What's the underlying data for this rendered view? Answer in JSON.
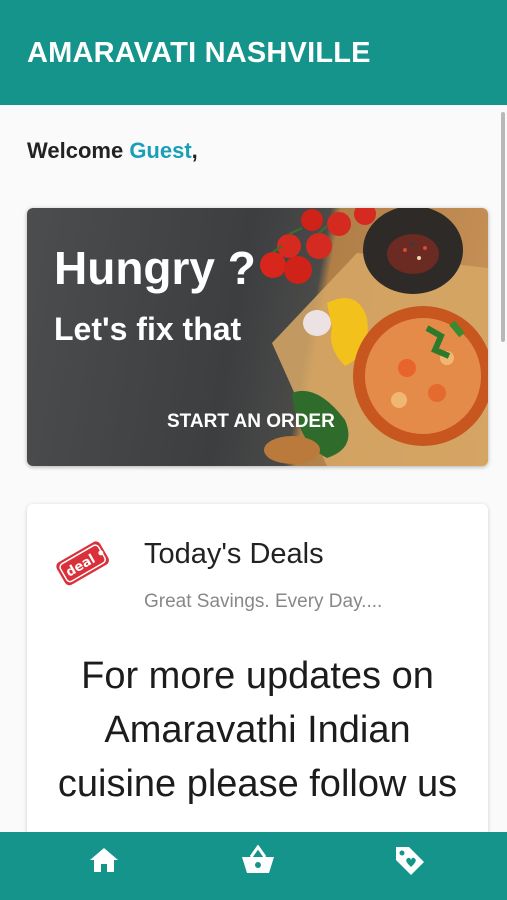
{
  "header": {
    "title": "AMARAVATI NASHVILLE"
  },
  "welcome": {
    "prefix": "Welcome ",
    "user": "Guest",
    "suffix": ","
  },
  "hero": {
    "title": "Hungry ?",
    "subtitle": "Let's fix that",
    "cta_label": "START AN ORDER"
  },
  "deals": {
    "icon_label": "deal",
    "title": "Today's Deals",
    "subtitle": "Great Savings. Every Day....",
    "body": "For more updates on Amaravathi Indian cuisine please follow us"
  },
  "bottom_nav": {
    "items": [
      {
        "icon": "home-icon"
      },
      {
        "icon": "basket-icon"
      },
      {
        "icon": "tag-icon"
      }
    ]
  },
  "colors": {
    "primary": "#14948a",
    "accent": "#1a9fb8"
  }
}
